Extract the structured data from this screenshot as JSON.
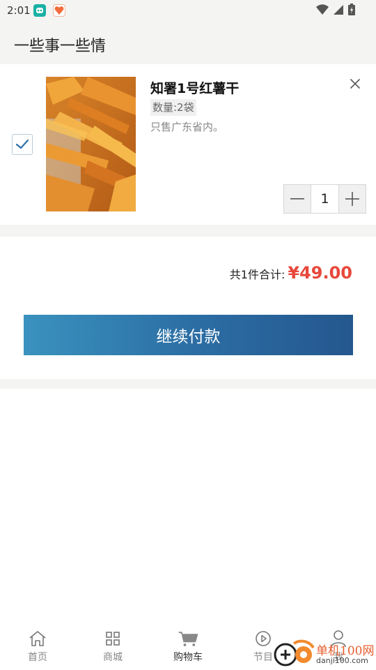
{
  "status_bar": {
    "time": "2:01"
  },
  "header": {
    "title": "一些事一些情"
  },
  "cart": {
    "items": [
      {
        "checked": true,
        "name": "知署1号红薯干",
        "spec": "数量:2袋",
        "note": "只售广东省内。",
        "quantity": "1"
      }
    ]
  },
  "summary": {
    "label": "共1件合计:",
    "total": "¥49.00"
  },
  "pay_button": {
    "label": "继续付款"
  },
  "bottom_nav": {
    "items": [
      {
        "label": "首页",
        "icon": "home-icon"
      },
      {
        "label": "商城",
        "icon": "grid-icon"
      },
      {
        "label": "购物车",
        "icon": "cart-icon",
        "active": true
      },
      {
        "label": "节目",
        "icon": "play-icon"
      },
      {
        "label": "我",
        "icon": "person-icon"
      }
    ]
  },
  "watermark": {
    "text": "单机100网",
    "url": "danji100.com"
  },
  "colors": {
    "price_red": "#e8473b",
    "button_blue_start": "#3a92be",
    "button_blue_end": "#24578e",
    "checkbox_blue": "#2f6fa8"
  }
}
